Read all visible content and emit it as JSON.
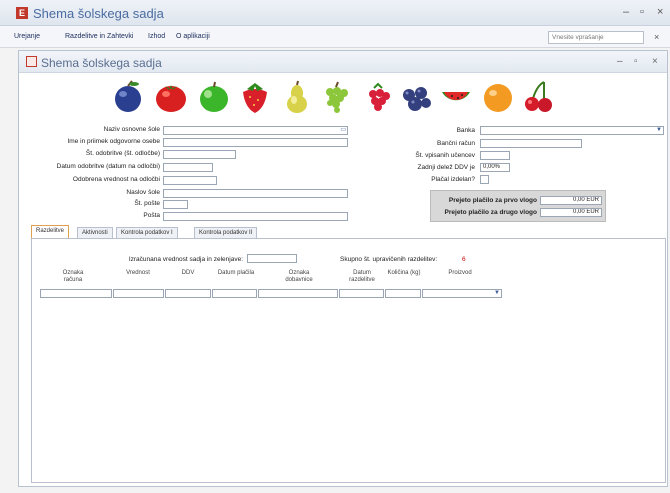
{
  "app": {
    "title": "Shema šolskega sadja",
    "icon_letter": "E",
    "menu": [
      "Urejanje",
      "Razdelitve in Zahtevki",
      "Izhod",
      "O aplikaciji"
    ],
    "help_placeholder": "Vnesite vprašanje"
  },
  "form": {
    "title": "Shema šolskega sadja",
    "fruits": [
      "plum-icon",
      "tomato-icon",
      "green-apple-icon",
      "strawberry-icon",
      "pear-icon",
      "grapes-icon",
      "raspberry-icon",
      "blueberries-icon",
      "watermelon-icon",
      "orange-icon",
      "cherries-icon"
    ],
    "left_fields": [
      {
        "label": "Naziv osnovne šole",
        "value": ""
      },
      {
        "label": "Ime in priimek odgovorne osebe",
        "value": ""
      },
      {
        "label": "Št. odobritve (št. odločbe)",
        "value": ""
      },
      {
        "label": "Datum odobritve (datum na odločbi)",
        "value": ""
      },
      {
        "label": "Odobrena vrednost na odločbi",
        "value": ""
      },
      {
        "label": "Naslov šole",
        "value": ""
      },
      {
        "label": "Št. pošte",
        "value": ""
      },
      {
        "label": "Pošta",
        "value": ""
      }
    ],
    "right_fields": {
      "banka_label": "Banka",
      "racun_label": "Bančni račun",
      "ucenci_label": "Št. vpisanih učencev",
      "ddv_label": "Zadnji delež DDV je",
      "ddv_value": "0,00%",
      "placilo_label": "Plačal izdelan?"
    },
    "payments": [
      {
        "label": "Prejeto plačilo za prvo vlogo",
        "value": "0,00 EUR"
      },
      {
        "label": "Prejeto plačilo za drugo vlogo",
        "value": "0,00 EUR"
      }
    ],
    "tabs": [
      "Razdelitve",
      "Aktivnosti",
      "Kontrola podatkov I",
      "Kontrola podatkov II"
    ],
    "active_tab": "Razdelitve",
    "panel": {
      "value_label": "Izračunana vrednost sadja in zelenjave:",
      "count_label": "Skupno št. upravičenih razdelitev:",
      "count_value": "6",
      "columns": [
        "Oznaka računa",
        "Vrednost",
        "DDV",
        "Datum plačila",
        "Oznaka dobavnice",
        "Datum razdelitve",
        "Količina (kg)",
        "Proizvod"
      ]
    }
  },
  "colors": {
    "accent": "#4a6ca0",
    "active_tab": "#e0a050",
    "count": "#c00000"
  }
}
